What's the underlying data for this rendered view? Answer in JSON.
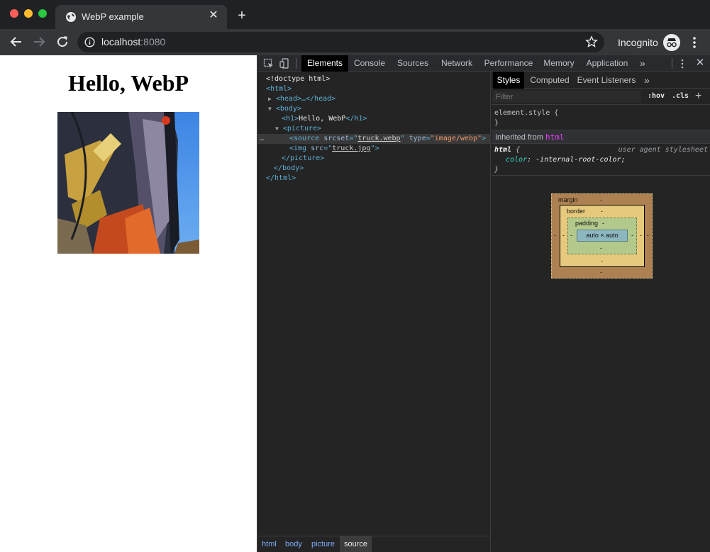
{
  "tab": {
    "title": "WebP example",
    "close": "✕",
    "new_tab": "+"
  },
  "toolbar": {
    "url_host": "localhost",
    "url_port": ":8080",
    "incognito_label": "Incognito"
  },
  "page": {
    "heading": "Hello, WebP"
  },
  "devtools": {
    "tabs": [
      "Elements",
      "Console",
      "Sources",
      "Network",
      "Performance",
      "Memory",
      "Application"
    ],
    "active_tab": "Elements",
    "more": "»",
    "close": "✕",
    "dom": {
      "doctype": "<!doctype html>",
      "html_open": "<html>",
      "head": "<head>…</head>",
      "body_open": "<body>",
      "h1_open": "<h1>",
      "h1_text": "Hello, WebP",
      "h1_close": "</h1>",
      "picture_open": "<picture>",
      "source_tag": "<source",
      "source_srcset_name": "srcset",
      "source_srcset_val": "truck.webp",
      "source_type_name": "type",
      "source_type_val": "\"image/webp\"",
      "source_close": ">",
      "img_tag": "<img",
      "img_src_name": "src",
      "img_src_val": "truck.jpg",
      "img_close": ">",
      "picture_close": "</picture>",
      "body_close": "</body>",
      "html_close": "</html>"
    },
    "breadcrumbs": [
      "html",
      "body",
      "picture",
      "source"
    ],
    "styles": {
      "tabs": [
        "Styles",
        "Computed",
        "Event Listeners"
      ],
      "more": "»",
      "filter_placeholder": "Filter",
      "hov": ":hov",
      "cls": ".cls",
      "plus": "+",
      "element_style": "element.style {",
      "close_brace": "}",
      "inherited_label": "Inherited from",
      "inherited_tag": "html",
      "rule_selector": "html",
      "rule_open": "{",
      "ua_label": "user agent stylesheet",
      "prop_name": "color",
      "prop_value": "-internal-root-color;",
      "box_model": {
        "margin_label": "margin",
        "border_label": "border",
        "padding_label": "padding",
        "content_label": "auto × auto",
        "dash": "-"
      }
    }
  },
  "colors": {
    "tab_active": "#35363a",
    "page_bg": "#ffffff",
    "devtools_bg": "#242424",
    "tag": "#5db0d7",
    "attr_val": "#f29766"
  }
}
